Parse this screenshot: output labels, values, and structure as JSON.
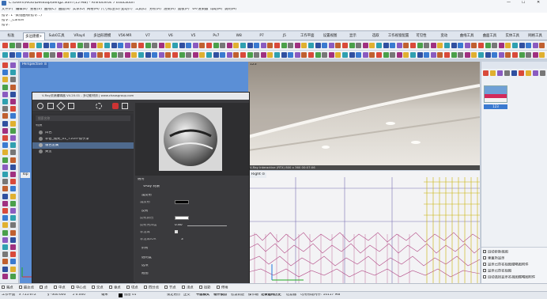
{
  "titlebar": {
    "text": "C:\\Users\\AIGO\\Desktop\\deng2.3dm (15 MB) - Rhinoceros 7 Education",
    "controls": [
      "—",
      "☐",
      "✕"
    ]
  },
  "menubar": {
    "items": [
      "文件(F)",
      "编辑(E)",
      "查看(V)",
      "曲线(C)",
      "曲面(S)",
      "实体(O)",
      "网格(M)",
      "尺寸标注(D)",
      "变动(T)",
      "工具(L)",
      "分析(A)",
      "渲染(R)",
      "面板(P)",
      "VR-渲染器",
      "帮助(H)",
      "说明(H)"
    ]
  },
  "command": {
    "history1": "指令: 1 *数组曲线(指令...)",
    "history2": "指令: _Cancel",
    "prompt": "指令:"
  },
  "tabs": [
    "标准",
    "多边建模+",
    "Sub0工具",
    "VRay4",
    "多边形建模",
    "V5K-MR",
    "V7",
    "V6",
    "V5",
    "Pv7",
    "W8",
    "P7",
    "J5",
    "工作平面",
    "设置视图",
    "显示",
    "选取",
    "工作视窗配置",
    "可见性",
    "变动",
    "曲线工具",
    "曲面工具",
    "实体工具",
    "网格工具"
  ],
  "active_tab_index": 1,
  "viewports": {
    "perspective": "Perspective ⊙",
    "top_label": "Top",
    "right_label": "Right ⊙",
    "render_title": "123°",
    "render_status": "V-Ray Interactive (RTX) 800 x 360 00:07:06"
  },
  "vray": {
    "title": "V-Ray资源编辑器 V4.20.01 - 多功能材质 | www.chaosgroup.com",
    "search_placeholder": "搜索名称",
    "tree_header": "材质",
    "tree_items": [
      "白色",
      "菲伯_抛光_01_75cm-镜子漆",
      "银色金属",
      "黄金"
    ],
    "selected_item": 2,
    "props_title": "通用",
    "props_subtitle": "VRay 材质",
    "sections": {
      "diffuse": "漫反射",
      "reflect": "反射",
      "refract": "折射",
      "bump": "透明度",
      "options": "选项",
      "maps": "贴图"
    },
    "props": {
      "diffuse_color": "漫反射",
      "reflect_color": "反射颜色",
      "glossiness": "反射光泽度",
      "glossiness_val": "0.80",
      "fresnel": "菲涅耳",
      "fresnel_ior": "菲涅耳IOR",
      "ior_val": "3",
      "refract": "折射",
      "opacity": "透明度"
    }
  },
  "rightpanel": {
    "swatch_label": "123",
    "checkboxes": [
      "自动更新视图",
      "重置所显示",
      "显示已命名视图缩略图附件",
      "显示已命名视图",
      "自动选择显示名视图缩略图附件"
    ]
  },
  "osnap": {
    "items": [
      "端点",
      "最近点",
      "点",
      "中点",
      "中心点",
      "交点",
      "垂点",
      "切点",
      "四分点",
      "节点",
      "顶点",
      "投影",
      "停用"
    ]
  },
  "status": {
    "cplane": "工作平面",
    "x": "x 755.672",
    "y": "y -300.600",
    "z": "z 0.000",
    "unit": "毫米",
    "layer": "图层 01",
    "lock": "锁定格点",
    "ortho": "正交",
    "planar": "平面模式",
    "osnap": "物件锁点",
    "smarttrack": "智慧轨迹",
    "gumball": "操作轴",
    "history": "记录建构历史",
    "filter": "过滤器",
    "memory": "可用物理内存: 10117 MB"
  }
}
